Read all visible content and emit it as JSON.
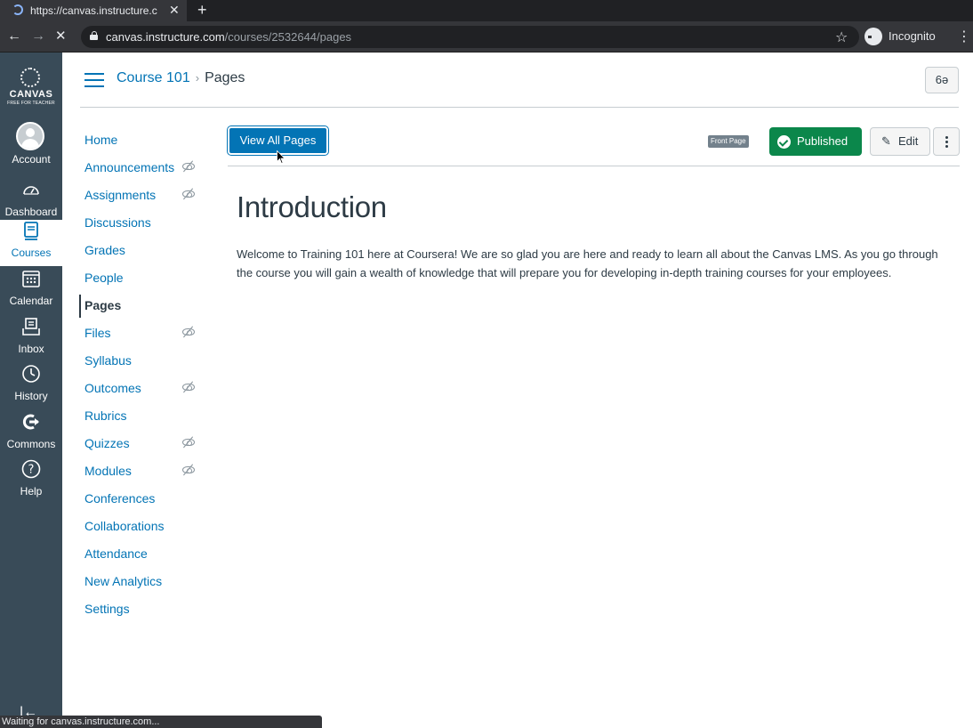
{
  "browser": {
    "tab_title": "https://canvas.instructure.c",
    "tab_close": "✕",
    "new_tab": "+",
    "back": "←",
    "forward": "→",
    "stop": "✕",
    "url_domain": "canvas.instructure.com",
    "url_path": "/courses/2532644/pages",
    "star": "☆",
    "profile_label": "Incognito",
    "menu": "⋮",
    "status_text": "Waiting for canvas.instructure.com..."
  },
  "global_nav": {
    "logo_text": "CANVAS",
    "logo_subtext": "FREE FOR TEACHER",
    "items": [
      {
        "label": "Account",
        "icon": "account-avatar"
      },
      {
        "label": "Dashboard",
        "icon": "dashboard-icon"
      },
      {
        "label": "Courses",
        "icon": "courses-icon"
      },
      {
        "label": "Calendar",
        "icon": "calendar-icon"
      },
      {
        "label": "Inbox",
        "icon": "inbox-icon"
      },
      {
        "label": "History",
        "icon": "history-icon"
      },
      {
        "label": "Commons",
        "icon": "commons-icon"
      },
      {
        "label": "Help",
        "icon": "help-icon"
      }
    ],
    "collapse_glyph": "|←"
  },
  "header": {
    "course": "Course 101",
    "separator": "›",
    "page": "Pages",
    "immersive_glyph": "6ə"
  },
  "course_nav": {
    "items": [
      {
        "label": "Home",
        "hidden": false
      },
      {
        "label": "Announcements",
        "hidden": true
      },
      {
        "label": "Assignments",
        "hidden": true
      },
      {
        "label": "Discussions",
        "hidden": false
      },
      {
        "label": "Grades",
        "hidden": false
      },
      {
        "label": "People",
        "hidden": false
      },
      {
        "label": "Pages",
        "hidden": false,
        "active": true
      },
      {
        "label": "Files",
        "hidden": true
      },
      {
        "label": "Syllabus",
        "hidden": false
      },
      {
        "label": "Outcomes",
        "hidden": true
      },
      {
        "label": "Rubrics",
        "hidden": false
      },
      {
        "label": "Quizzes",
        "hidden": true
      },
      {
        "label": "Modules",
        "hidden": true
      },
      {
        "label": "Conferences",
        "hidden": false
      },
      {
        "label": "Collaborations",
        "hidden": false
      },
      {
        "label": "Attendance",
        "hidden": false
      },
      {
        "label": "New Analytics",
        "hidden": false
      },
      {
        "label": "Settings",
        "hidden": false
      }
    ]
  },
  "toolbar": {
    "view_all_label": "View All Pages",
    "front_page_badge": "Front Page",
    "published_label": "Published",
    "edit_label": "Edit",
    "edit_glyph": "✎"
  },
  "page": {
    "title": "Introduction",
    "body": "Welcome to Training 101 here at Coursera! We are so glad you are here and ready to learn all about the Canvas LMS. As you go through the course you will gain a wealth of knowledge that will prepare you for developing in-depth training courses for your employees."
  },
  "colors": {
    "nav_bg": "#394b58",
    "link": "#0374b5",
    "published": "#0b874b",
    "text": "#2d3b45"
  }
}
